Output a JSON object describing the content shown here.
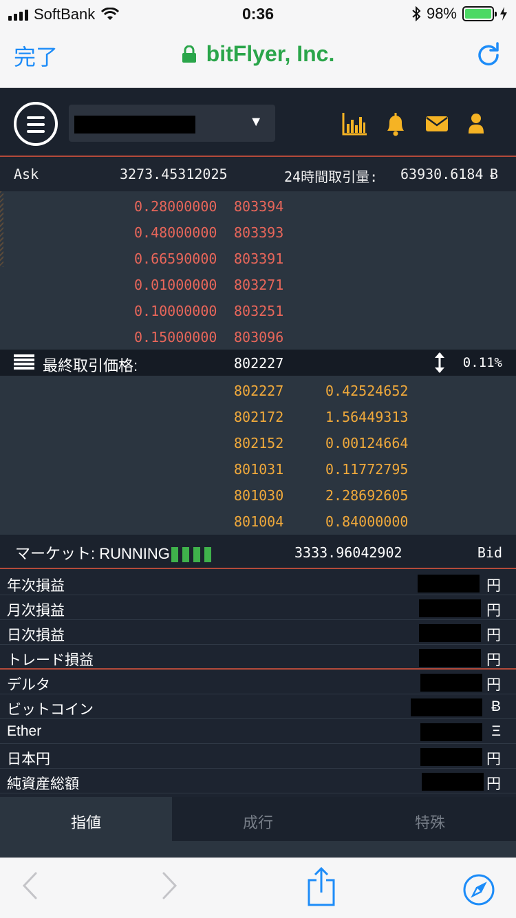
{
  "status_bar": {
    "carrier": "SoftBank",
    "time": "0:36",
    "battery": "98%"
  },
  "browser": {
    "done_label": "完了",
    "site_title": "bitFlyer, Inc."
  },
  "ask_row": {
    "label": "Ask",
    "value": "3273.45312025",
    "volume_label": "24時間取引量:",
    "volume_value": "63930.6184",
    "volume_unit": "Ƀ"
  },
  "asks": [
    {
      "qty": "0.28000000",
      "price": "803394"
    },
    {
      "qty": "0.48000000",
      "price": "803393"
    },
    {
      "qty": "0.66590000",
      "price": "803391"
    },
    {
      "qty": "0.01000000",
      "price": "803271"
    },
    {
      "qty": "0.10000000",
      "price": "803251"
    },
    {
      "qty": "0.15000000",
      "price": "803096"
    }
  ],
  "last_trade": {
    "label": "最終取引価格:",
    "price": "802227",
    "change": "0.11%"
  },
  "bids": [
    {
      "price": "802227",
      "qty": "0.42524652"
    },
    {
      "price": "802172",
      "qty": "1.56449313"
    },
    {
      "price": "802152",
      "qty": "0.00124664"
    },
    {
      "price": "801031",
      "qty": "0.11772795"
    },
    {
      "price": "801030",
      "qty": "2.28692605"
    },
    {
      "price": "801004",
      "qty": "0.84000000"
    }
  ],
  "market": {
    "label": "マーケット: RUNNING",
    "value": "3333.96042902",
    "side": "Bid"
  },
  "balances": [
    {
      "name": "年次損益",
      "unit": "円"
    },
    {
      "name": "月次損益",
      "unit": "円"
    },
    {
      "name": "日次損益",
      "unit": "円"
    },
    {
      "name": "トレード損益",
      "unit": "円"
    },
    {
      "name": "デルタ",
      "unit": "円"
    },
    {
      "name": "ビットコイン",
      "unit": "Ƀ"
    },
    {
      "name": "Ether",
      "unit": "Ξ"
    },
    {
      "name": "日本円",
      "unit": "円"
    },
    {
      "name": "純資産総額",
      "unit": "円"
    }
  ],
  "order_tabs": [
    {
      "label": "指値"
    },
    {
      "label": "成行"
    },
    {
      "label": "特殊"
    }
  ],
  "colors": {
    "ask": "#e8665a",
    "bid": "#f0a93b",
    "accent_icons": "#f5b324",
    "link": "#1d8cf8",
    "secure": "#2aa54a"
  }
}
